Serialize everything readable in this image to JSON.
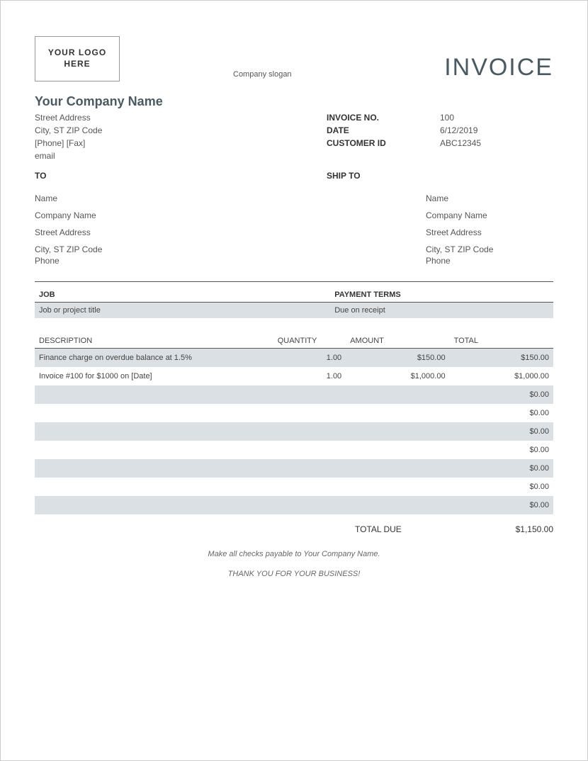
{
  "header": {
    "logo_text": "YOUR LOGO HERE",
    "slogan": "Company slogan",
    "doc_title": "INVOICE"
  },
  "company": {
    "name": "Your Company Name",
    "street": "Street Address",
    "city": "City, ST  ZIP Code",
    "phone_fax": "[Phone]  [Fax]",
    "email": "email"
  },
  "meta": {
    "labels": {
      "invoice_no": "INVOICE NO.",
      "date": "DATE",
      "customer_id": "CUSTOMER ID"
    },
    "invoice_no": "100",
    "date": "6/12/2019",
    "customer_id": "ABC12345"
  },
  "sections": {
    "to": "TO",
    "ship_to": "SHIP TO"
  },
  "bill_to": {
    "name": "Name",
    "company": "Company Name",
    "street": "Street Address",
    "city": "City, ST  ZIP Code",
    "phone": "Phone"
  },
  "ship_to": {
    "name": "Name",
    "company": "Company Name",
    "street": "Street Address",
    "city": "City, ST  ZIP Code",
    "phone": "Phone"
  },
  "job": {
    "headers": {
      "job": "JOB",
      "terms": "PAYMENT TERMS"
    },
    "title": "Job or project title",
    "terms": "Due on receipt"
  },
  "items": {
    "headers": {
      "desc": "DESCRIPTION",
      "qty": "QUANTITY",
      "amount": "AMOUNT",
      "total": "TOTAL"
    },
    "rows": [
      {
        "desc": "Finance charge on overdue balance at 1.5%",
        "qty": "1.00",
        "amount": "$150.00",
        "total": "$150.00"
      },
      {
        "desc": "Invoice #100 for $1000 on [Date]",
        "qty": "1.00",
        "amount": "$1,000.00",
        "total": "$1,000.00"
      },
      {
        "desc": "",
        "qty": "",
        "amount": "",
        "total": "$0.00"
      },
      {
        "desc": "",
        "qty": "",
        "amount": "",
        "total": "$0.00"
      },
      {
        "desc": "",
        "qty": "",
        "amount": "",
        "total": "$0.00"
      },
      {
        "desc": "",
        "qty": "",
        "amount": "",
        "total": "$0.00"
      },
      {
        "desc": "",
        "qty": "",
        "amount": "",
        "total": "$0.00"
      },
      {
        "desc": "",
        "qty": "",
        "amount": "",
        "total": "$0.00"
      },
      {
        "desc": "",
        "qty": "",
        "amount": "",
        "total": "$0.00"
      }
    ]
  },
  "totals": {
    "label": "TOTAL DUE",
    "value": "$1,150.00"
  },
  "footer": {
    "check_note": "Make all checks payable to Your Company Name.",
    "thanks": "THANK YOU FOR YOUR BUSINESS!"
  }
}
